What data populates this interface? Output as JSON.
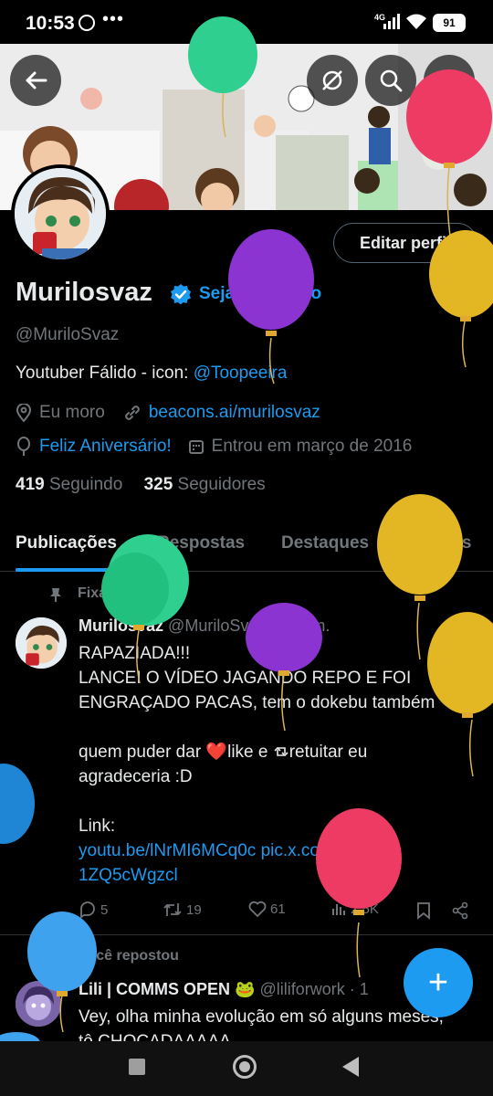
{
  "status_bar": {
    "time": "10:53",
    "dots": "•••",
    "network": "4G",
    "battery": "91"
  },
  "profile": {
    "name": "Murilosvaz",
    "verify_cta": "Seja verificado",
    "handle": "@MuriloSvaz",
    "bio_text": "Youtuber Fálido - icon: ",
    "bio_mention": "@Toopeeira",
    "location": "Eu moro",
    "website": "beacons.ai/murilosvaz",
    "birthday": "Feliz Aniversário!",
    "joined": "Entrou em março de 2016",
    "following_count": "419",
    "following_label": "Seguindo",
    "followers_count": "325",
    "followers_label": "Seguidores",
    "edit_button": "Editar perfil"
  },
  "tabs": [
    {
      "label": "Publicações",
      "active": true
    },
    {
      "label": "Respostas",
      "active": false
    },
    {
      "label": "Destaques",
      "active": false
    },
    {
      "label": "Artigos",
      "active": false
    }
  ],
  "pinned_post": {
    "pinned_label": "Fixado",
    "author": "Murilosvaz",
    "handle_time": "@MuriloSvaz · 30 jun.",
    "lines": [
      "RAPAZIADA!!!",
      "LANCEI O VÍDEO JAGANDO REPO E FOI",
      "ENGRAÇADO PACAS, tem o dokebu também",
      "",
      "quem puder dar ",
      "agradeceria :D",
      "",
      "Link:"
    ],
    "heart_emoji": "❤️",
    "like_text": "like e ",
    "retweet_text": "retuitar eu",
    "link_line1": "youtu.be/lNrMI6MCq0c pic.x.com/",
    "link_line2": "1ZQ5cWgzcl",
    "stats": {
      "replies": "5",
      "retweets": "19",
      "likes": "61",
      "views": "2,5K"
    }
  },
  "repost": {
    "repost_label": "Você repostou",
    "author": "Lili | COMMS OPEN",
    "author_emoji": "🐸",
    "handle_time": "@liliforwork · 1",
    "text_line1": "Vey, olha minha evolução em só alguns meses,",
    "text_line2": "tô CHOCADAAAAA"
  },
  "fab_label": "+",
  "colors": {
    "accent": "#1d9bf0",
    "background": "#000000",
    "muted": "#71767b"
  }
}
